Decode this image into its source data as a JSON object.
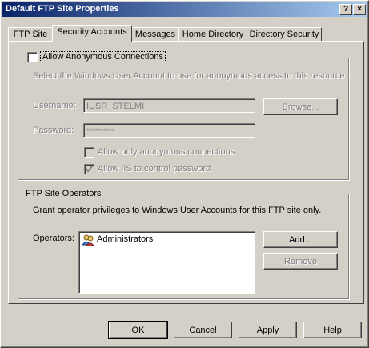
{
  "window": {
    "title": "Default FTP Site Properties",
    "help_btn": "?",
    "close_btn": "×"
  },
  "tabs": [
    {
      "label": "FTP Site"
    },
    {
      "label": "Security Accounts"
    },
    {
      "label": "Messages"
    },
    {
      "label": "Home Directory"
    },
    {
      "label": "Directory Security"
    }
  ],
  "anonymous": {
    "checkbox_label": "Allow Anonymous Connections",
    "description": "Select the Windows User Account to use for anonymous access to this resource",
    "username_label": "Username:",
    "username_value": "IUSR_STELMI",
    "browse_label": "Browse...",
    "password_label": "Password:",
    "password_value": "**********",
    "only_anon_label": "Allow only anonymous connections",
    "iis_pwd_label": "Allow IIS to control password"
  },
  "operators": {
    "group_label": "FTP Site Operators",
    "description": "Grant operator privileges to Windows User Accounts for this FTP site only.",
    "operators_label": "Operators:",
    "list": [
      "Administrators"
    ],
    "add_label": "Add...",
    "remove_label": "Remove"
  },
  "footer": {
    "ok": "OK",
    "cancel": "Cancel",
    "apply": "Apply",
    "help": "Help"
  }
}
